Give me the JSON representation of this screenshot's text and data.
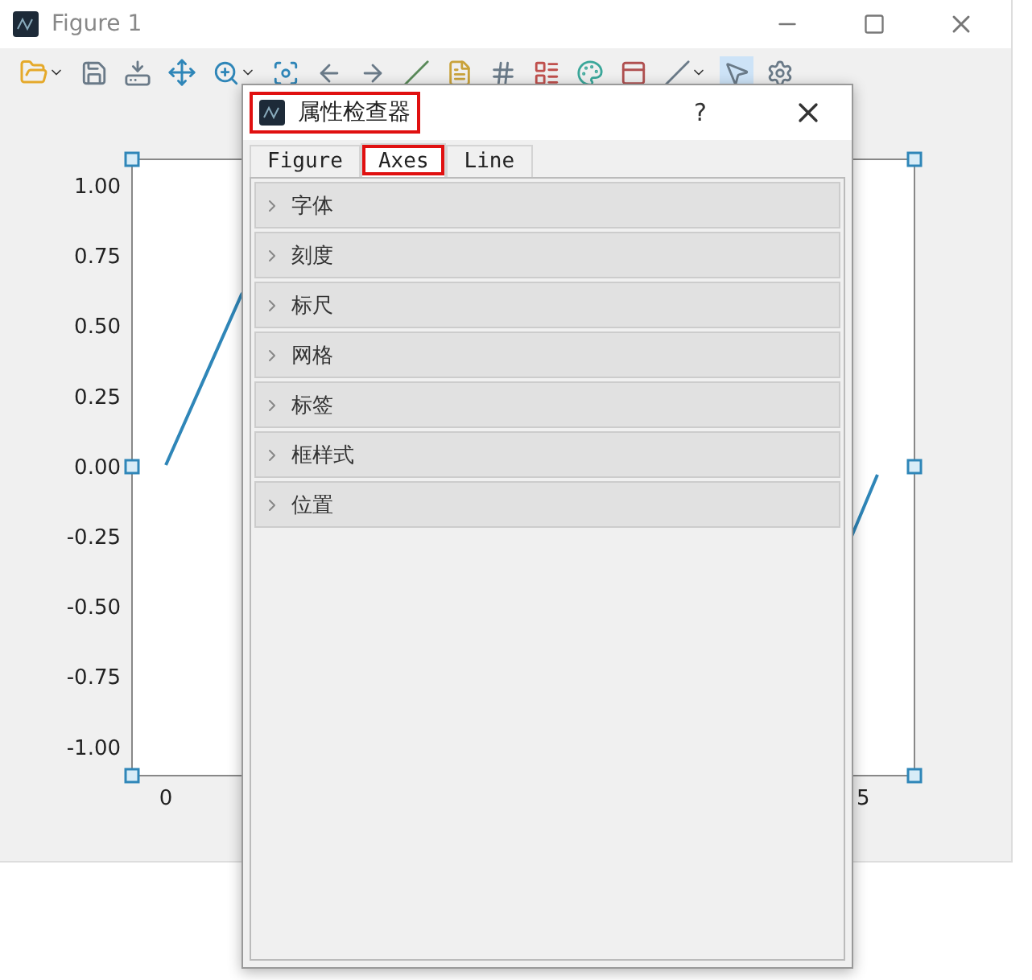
{
  "window": {
    "title": "Figure 1"
  },
  "plot": {
    "y_tick_labels": [
      "1.00",
      "0.75",
      "0.50",
      "0.25",
      "0.00",
      "-0.25",
      "-0.50",
      "-0.75",
      "-1.00"
    ],
    "x_tick_labels": [
      "0",
      "5"
    ]
  },
  "dialog": {
    "title": "属性检查器",
    "title_highlighted": true,
    "help": "?",
    "tabs": [
      {
        "label": "Figure",
        "selected": false,
        "highlighted": false
      },
      {
        "label": "Axes",
        "selected": true,
        "highlighted": true
      },
      {
        "label": "Line",
        "selected": false,
        "highlighted": false
      }
    ],
    "sections": [
      {
        "label": "字体",
        "expanded": false
      },
      {
        "label": "刻度",
        "expanded": false
      },
      {
        "label": "标尺",
        "expanded": false
      },
      {
        "label": "网格",
        "expanded": false
      },
      {
        "label": "标签",
        "expanded": false
      },
      {
        "label": "框样式",
        "expanded": false
      },
      {
        "label": "位置",
        "expanded": false
      }
    ]
  }
}
